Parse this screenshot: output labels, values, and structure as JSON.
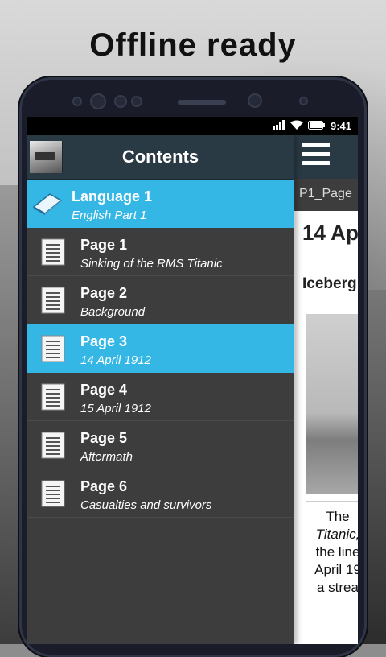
{
  "headline": "Offline ready",
  "status": {
    "time": "9:41"
  },
  "drawer": {
    "title": "Contents",
    "language": {
      "title": "Language 1",
      "subtitle": "English Part 1"
    },
    "items": [
      {
        "title": "Page 1",
        "subtitle": "Sinking of the RMS Titanic",
        "selected": false
      },
      {
        "title": "Page 2",
        "subtitle": "Background",
        "selected": false
      },
      {
        "title": "Page 3",
        "subtitle": "14 April 1912",
        "selected": true
      },
      {
        "title": "Page 4",
        "subtitle": "15 April 1912",
        "selected": false
      },
      {
        "title": "Page 5",
        "subtitle": "Aftermath",
        "selected": false
      },
      {
        "title": "Page 6",
        "subtitle": "Casualties and survivors",
        "selected": false
      }
    ]
  },
  "main": {
    "tab_label": "P1_Page",
    "title": "14 Ap",
    "subtitle": "Iceberg",
    "caption_lines": [
      "The",
      "Titanic,",
      "the line",
      "April 19",
      "a strea"
    ]
  },
  "colors": {
    "accent": "#35b7e6",
    "drawer_bg": "#3d3d3d",
    "header_bg": "#2a3a45"
  }
}
